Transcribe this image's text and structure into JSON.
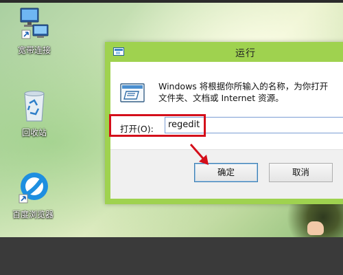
{
  "desktop": {
    "icons": [
      {
        "label": "宽带连接",
        "icon": "network-connection-icon"
      },
      {
        "label": "回收站",
        "icon": "recycle-bin-icon"
      },
      {
        "label": "百度浏览器",
        "icon": "baidu-browser-icon"
      }
    ]
  },
  "run_dialog": {
    "title": "运行",
    "description_line1": "Windows 将根据你所输入的名称，为你打开",
    "description_line2": "文件夹、文档或 Internet 资源。",
    "open_label": "打开(O):",
    "open_value": "regedit",
    "ok_label": "确定",
    "cancel_label": "取消",
    "accent_color": "#9fd24f",
    "annotation_color": "#d40e1a"
  }
}
